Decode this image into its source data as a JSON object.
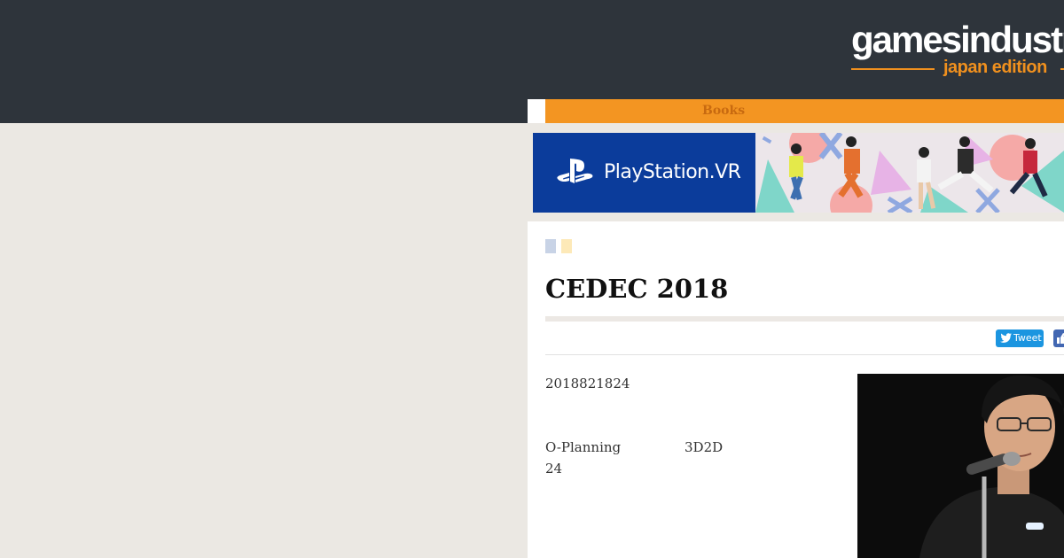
{
  "header": {
    "logo_main": "gamesindustry",
    "logo_sub": "japan edition"
  },
  "nav": {
    "items": [
      {
        "label": "Books"
      }
    ]
  },
  "ad": {
    "brand": "PlayStation.VR",
    "logo_icon": "playstation-logo-icon"
  },
  "article": {
    "title": "CEDEC 2018",
    "date": "2018821824",
    "paragraph": {
      "col1_line1": "O-Planning",
      "col2_line1": "3D2D",
      "line2": "24"
    },
    "share": {
      "tweet_label": "Tweet",
      "tweet_icon": "twitter-bird-icon",
      "facebook_icon": "facebook-like-icon"
    },
    "badges": [
      "#c8d3e6",
      "#fde9b8"
    ]
  },
  "colors": {
    "header_bg": "#2e343b",
    "accent_orange": "#f39522",
    "page_bg": "#ebe8e3",
    "ps_blue": "#0b3c9b",
    "twitter_blue": "#1b95e0"
  }
}
